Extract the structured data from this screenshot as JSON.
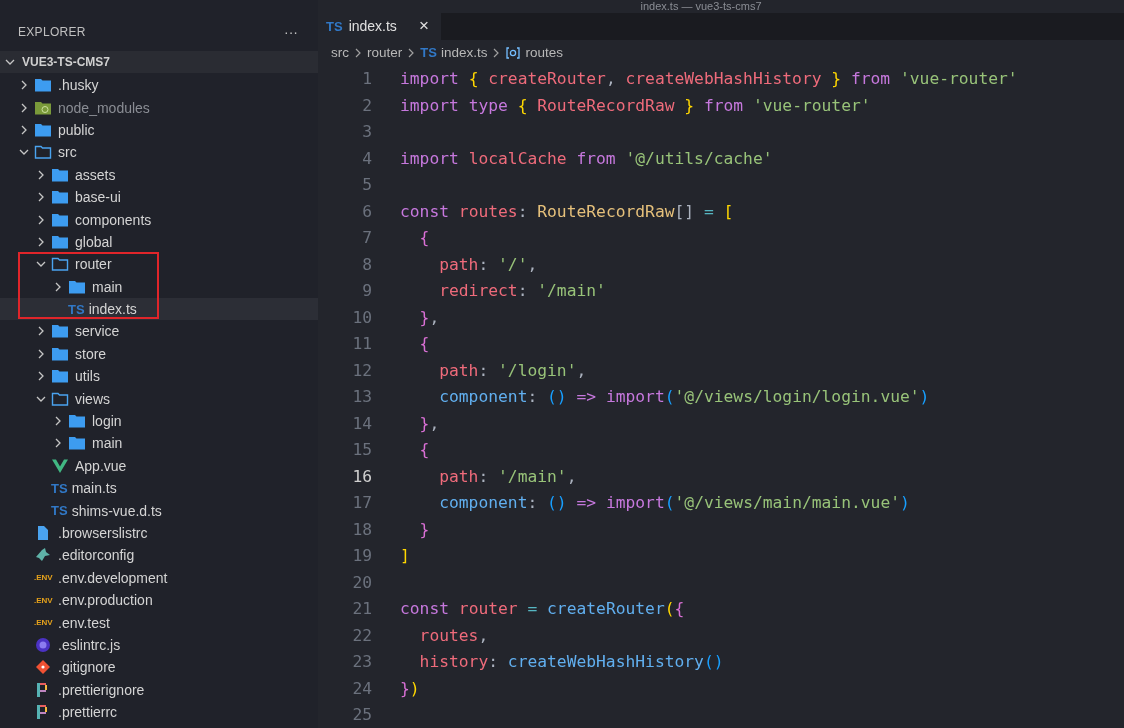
{
  "window": {
    "title": "index.ts — vue3-ts-cms7"
  },
  "sidebar": {
    "title": "EXPLORER",
    "more": "···",
    "project": {
      "label": "VUE3-TS-CMS7",
      "expanded": true
    },
    "tree": [
      {
        "label": ".husky",
        "kind": "folder",
        "expanded": false,
        "selected": false,
        "outlined": false
      },
      {
        "label": "node_modules",
        "kind": "package",
        "expanded": false,
        "selected": false,
        "outlined": false,
        "dimmed": true
      },
      {
        "label": "public",
        "kind": "folder",
        "expanded": false,
        "selected": false,
        "outlined": false
      },
      {
        "label": "src",
        "kind": "folder",
        "expanded": true,
        "selected": false,
        "outlined": false,
        "children": [
          {
            "label": "assets",
            "kind": "folder",
            "expanded": false,
            "selected": false,
            "outlined": false
          },
          {
            "label": "base-ui",
            "kind": "folder",
            "expanded": false,
            "selected": false,
            "outlined": false
          },
          {
            "label": "components",
            "kind": "folder",
            "expanded": false,
            "selected": false,
            "outlined": false
          },
          {
            "label": "global",
            "kind": "folder",
            "expanded": false,
            "selected": false,
            "outlined": false
          },
          {
            "label": "router",
            "kind": "folder",
            "expanded": true,
            "selected": false,
            "outlined": true,
            "children": [
              {
                "label": "main",
                "kind": "folder",
                "expanded": false,
                "selected": false,
                "outlined": false
              },
              {
                "label": "index.ts",
                "kind": "ts",
                "badge": "TS",
                "selected": true,
                "outlined": false
              }
            ]
          },
          {
            "label": "service",
            "kind": "folder",
            "expanded": false,
            "selected": false,
            "outlined": false
          },
          {
            "label": "store",
            "kind": "folder",
            "expanded": false,
            "selected": false,
            "outlined": false
          },
          {
            "label": "utils",
            "kind": "folder",
            "expanded": false,
            "selected": false,
            "outlined": false
          },
          {
            "label": "views",
            "kind": "folder",
            "expanded": true,
            "selected": false,
            "outlined": false,
            "children": [
              {
                "label": "login",
                "kind": "folder",
                "expanded": false,
                "selected": false,
                "outlined": false
              },
              {
                "label": "main",
                "kind": "folder",
                "expanded": false,
                "selected": false,
                "outlined": false
              }
            ]
          },
          {
            "label": "App.vue",
            "kind": "vue",
            "selected": false,
            "outlined": false
          },
          {
            "label": "main.ts",
            "kind": "ts",
            "badge": "TS",
            "selected": false,
            "outlined": false
          },
          {
            "label": "shims-vue.d.ts",
            "kind": "ts",
            "badge": "TS",
            "selected": false,
            "outlined": false
          }
        ]
      },
      {
        "label": ".browserslistrc",
        "kind": "file",
        "selected": false,
        "outlined": false
      },
      {
        "label": ".editorconfig",
        "kind": "editorconfig",
        "selected": false,
        "outlined": false
      },
      {
        "label": ".env.development",
        "kind": "env",
        "badge": ".ENV",
        "selected": false,
        "outlined": false
      },
      {
        "label": ".env.production",
        "kind": "env",
        "badge": ".ENV",
        "selected": false,
        "outlined": false
      },
      {
        "label": ".env.test",
        "kind": "env",
        "badge": ".ENV",
        "selected": false,
        "outlined": false
      },
      {
        "label": ".eslintrc.js",
        "kind": "eslint",
        "selected": false,
        "outlined": false
      },
      {
        "label": ".gitignore",
        "kind": "git",
        "selected": false,
        "outlined": false
      },
      {
        "label": ".prettierignore",
        "kind": "prettier",
        "selected": false,
        "outlined": false
      },
      {
        "label": ".prettierrc",
        "kind": "prettier",
        "selected": false,
        "outlined": false
      }
    ]
  },
  "tabs": [
    {
      "label": "index.ts",
      "badge": "TS",
      "close": "×",
      "selected": true
    }
  ],
  "breadcrumbs": [
    {
      "label": "src",
      "kind": "text"
    },
    {
      "label": "router",
      "kind": "text"
    },
    {
      "label": "index.ts",
      "kind": "ts",
      "badge": "TS"
    },
    {
      "label": "routes",
      "kind": "symbol"
    }
  ],
  "code": [
    {
      "n": "1",
      "active": false,
      "tokens": [
        {
          "t": "import ",
          "kind": "kw"
        },
        {
          "t": "{ ",
          "kind": "b1"
        },
        {
          "t": "createRouter",
          "kind": "id"
        },
        {
          "t": ", ",
          "kind": "plain"
        },
        {
          "t": "createWebHashHistory ",
          "kind": "id"
        },
        {
          "t": "} ",
          "kind": "b1"
        },
        {
          "t": "from ",
          "kind": "kw"
        },
        {
          "t": "'vue-router'",
          "kind": "str"
        }
      ]
    },
    {
      "n": "2",
      "active": false,
      "tokens": [
        {
          "t": "import ",
          "kind": "kw"
        },
        {
          "t": "type ",
          "kind": "kw"
        },
        {
          "t": "{ ",
          "kind": "b1"
        },
        {
          "t": "RouteRecordRaw ",
          "kind": "id"
        },
        {
          "t": "} ",
          "kind": "b1"
        },
        {
          "t": "from ",
          "kind": "kw"
        },
        {
          "t": "'vue-router'",
          "kind": "str"
        }
      ]
    },
    {
      "n": "3",
      "active": false
    },
    {
      "n": "4",
      "active": false,
      "tokens": [
        {
          "t": "import ",
          "kind": "kw"
        },
        {
          "t": "localCache ",
          "kind": "id"
        },
        {
          "t": "from ",
          "kind": "kw"
        },
        {
          "t": "'@/utils/cache'",
          "kind": "str"
        }
      ]
    },
    {
      "n": "5",
      "active": false
    },
    {
      "n": "6",
      "active": false,
      "tokens": [
        {
          "t": "const ",
          "kind": "kw"
        },
        {
          "t": "routes",
          "kind": "id"
        },
        {
          "t": ": ",
          "kind": "plain"
        },
        {
          "t": "RouteRecordRaw",
          "kind": "type"
        },
        {
          "t": "[] ",
          "kind": "plain"
        },
        {
          "t": "= ",
          "kind": "op"
        },
        {
          "t": "[",
          "kind": "b1"
        }
      ]
    },
    {
      "n": "7",
      "active": false,
      "tokens": [
        {
          "t": "  {",
          "kind": "b2"
        }
      ]
    },
    {
      "n": "8",
      "active": false,
      "tokens": [
        {
          "t": "    path",
          "kind": "id"
        },
        {
          "t": ": ",
          "kind": "plain"
        },
        {
          "t": "'/'",
          "kind": "str"
        },
        {
          "t": ",",
          "kind": "plain"
        }
      ]
    },
    {
      "n": "9",
      "active": false,
      "tokens": [
        {
          "t": "    redirect",
          "kind": "id"
        },
        {
          "t": ": ",
          "kind": "plain"
        },
        {
          "t": "'/main'",
          "kind": "str"
        }
      ]
    },
    {
      "n": "10",
      "active": false,
      "tokens": [
        {
          "t": "  }",
          "kind": "b2"
        },
        {
          "t": ",",
          "kind": "plain"
        }
      ]
    },
    {
      "n": "11",
      "active": false,
      "tokens": [
        {
          "t": "  {",
          "kind": "b2"
        }
      ]
    },
    {
      "n": "12",
      "active": false,
      "tokens": [
        {
          "t": "    path",
          "kind": "id"
        },
        {
          "t": ": ",
          "kind": "plain"
        },
        {
          "t": "'/login'",
          "kind": "str"
        },
        {
          "t": ",",
          "kind": "plain"
        }
      ]
    },
    {
      "n": "13",
      "active": false,
      "tokens": [
        {
          "t": "    component",
          "kind": "fn"
        },
        {
          "t": ": ",
          "kind": "plain"
        },
        {
          "t": "() ",
          "kind": "b3"
        },
        {
          "t": "=> ",
          "kind": "kw"
        },
        {
          "t": "import",
          "kind": "kw"
        },
        {
          "t": "(",
          "kind": "b3"
        },
        {
          "t": "'@/views/login/login.vue'",
          "kind": "str"
        },
        {
          "t": ")",
          "kind": "b3"
        }
      ]
    },
    {
      "n": "14",
      "active": false,
      "tokens": [
        {
          "t": "  }",
          "kind": "b2"
        },
        {
          "t": ",",
          "kind": "plain"
        }
      ]
    },
    {
      "n": "15",
      "active": false,
      "tokens": [
        {
          "t": "  {",
          "kind": "b2"
        }
      ]
    },
    {
      "n": "16",
      "active": true,
      "tokens": [
        {
          "t": "    path",
          "kind": "id"
        },
        {
          "t": ": ",
          "kind": "plain"
        },
        {
          "t": "'/main'",
          "kind": "str"
        },
        {
          "t": ",",
          "kind": "plain"
        }
      ]
    },
    {
      "n": "17",
      "active": false,
      "tokens": [
        {
          "t": "    component",
          "kind": "fn"
        },
        {
          "t": ": ",
          "kind": "plain"
        },
        {
          "t": "() ",
          "kind": "b3"
        },
        {
          "t": "=> ",
          "kind": "kw"
        },
        {
          "t": "import",
          "kind": "kw"
        },
        {
          "t": "(",
          "kind": "b3"
        },
        {
          "t": "'@/views/main/main.vue'",
          "kind": "str"
        },
        {
          "t": ")",
          "kind": "b3"
        }
      ]
    },
    {
      "n": "18",
      "active": false,
      "tokens": [
        {
          "t": "  }",
          "kind": "b2"
        }
      ]
    },
    {
      "n": "19",
      "active": false,
      "tokens": [
        {
          "t": "]",
          "kind": "b1"
        }
      ]
    },
    {
      "n": "20",
      "active": false
    },
    {
      "n": "21",
      "active": false,
      "tokens": [
        {
          "t": "const ",
          "kind": "kw"
        },
        {
          "t": "router ",
          "kind": "id"
        },
        {
          "t": "= ",
          "kind": "op"
        },
        {
          "t": "createRouter",
          "kind": "fn"
        },
        {
          "t": "(",
          "kind": "b1"
        },
        {
          "t": "{",
          "kind": "b2"
        }
      ]
    },
    {
      "n": "22",
      "active": false,
      "tokens": [
        {
          "t": "  routes",
          "kind": "id"
        },
        {
          "t": ",",
          "kind": "plain"
        }
      ]
    },
    {
      "n": "23",
      "active": false,
      "tokens": [
        {
          "t": "  history",
          "kind": "id"
        },
        {
          "t": ": ",
          "kind": "plain"
        },
        {
          "t": "createWebHashHistory",
          "kind": "fn"
        },
        {
          "t": "()",
          "kind": "b3"
        }
      ]
    },
    {
      "n": "24",
      "active": false,
      "tokens": [
        {
          "t": "}",
          "kind": "b2"
        },
        {
          "t": ")",
          "kind": "b1"
        }
      ]
    },
    {
      "n": "25",
      "active": false
    }
  ]
}
